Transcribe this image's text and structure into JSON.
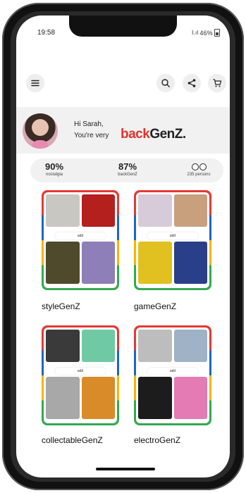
{
  "status": {
    "time": "19:58",
    "signal_battery": "46%"
  },
  "header": {
    "menu_icon": "menu-icon",
    "search_icon": "search-icon",
    "share_icon": "share-icon",
    "cart_icon": "cart-icon"
  },
  "greeting": {
    "hello": "Hi Sarah,",
    "prefix": "You're very",
    "brand_back": "back",
    "brand_genz": "GenZ."
  },
  "stats": [
    {
      "value": "90%",
      "label": "nostalgia"
    },
    {
      "value": "87%",
      "label": "backGenZ"
    },
    {
      "value": "",
      "label": "235 persons"
    }
  ],
  "categories": [
    {
      "label": "styleGenZ",
      "add": "add"
    },
    {
      "label": "gameGenZ",
      "add": "add"
    },
    {
      "label": "collectableGenZ",
      "add": "add"
    },
    {
      "label": "electroGenZ",
      "add": "add"
    }
  ]
}
